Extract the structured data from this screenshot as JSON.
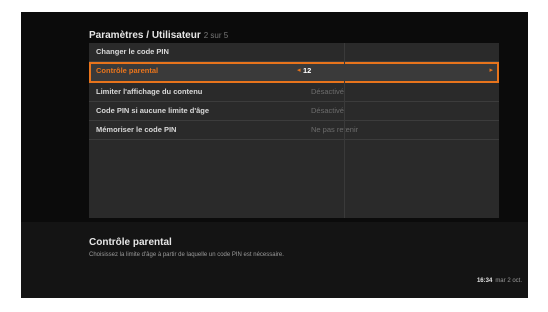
{
  "header": {
    "title": "Paramètres / Utilisateur",
    "page_indicator": "2 sur 5"
  },
  "menu": {
    "items": [
      {
        "label": "Changer le code PIN",
        "value": ""
      },
      {
        "label": "Contrôle parental",
        "value": "12"
      },
      {
        "label": "Limiter l'affichage du contenu",
        "value": "Désactivé"
      },
      {
        "label": "Code PIN si aucune limite d'âge",
        "value": "Désactivé"
      },
      {
        "label": "Mémoriser le code PIN",
        "value": "Ne pas retenir"
      }
    ]
  },
  "selected_arrows": {
    "left": "◂",
    "right": "▸"
  },
  "info": {
    "title": "Contrôle parental",
    "description": "Choisissez la limite d'âge à partir de laquelle un code PIN est nécessaire."
  },
  "status": {
    "time": "16:34",
    "date": "mar 2 oct."
  },
  "colors": {
    "accent": "#e8741c",
    "background": "#0b0b0b",
    "panel": "#2a2a2a"
  }
}
